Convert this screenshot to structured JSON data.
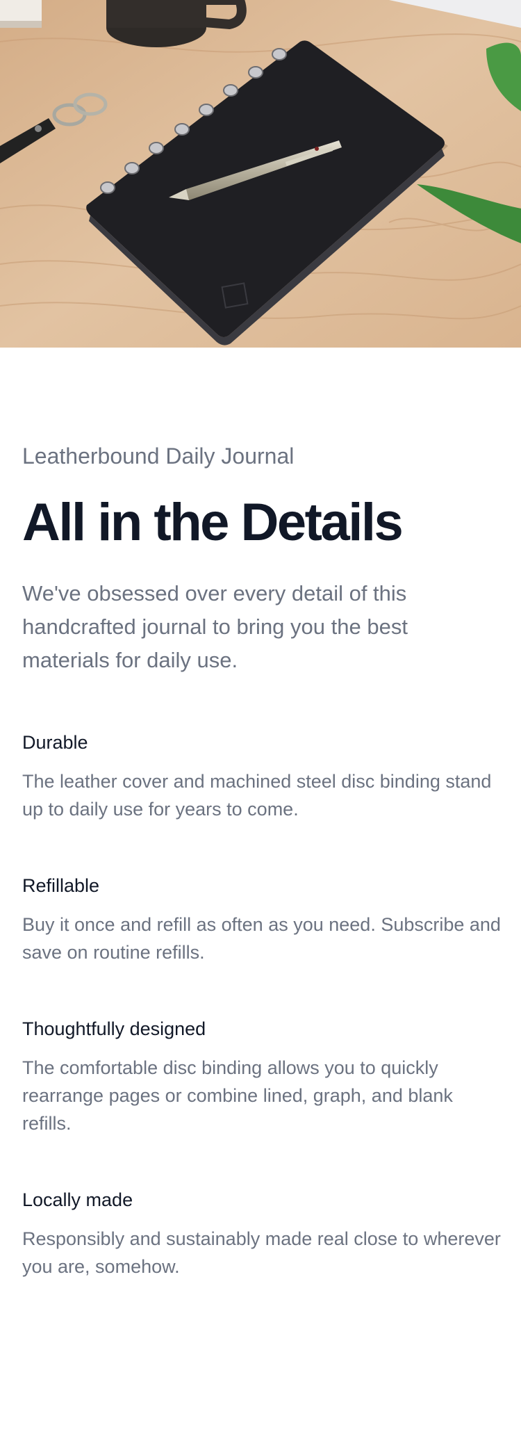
{
  "hero": {
    "image_alt": "Black leather journal with steel disc binding and a silver pen on a light wooden desk, next to a mug, keychain and a green plant"
  },
  "product": {
    "eyebrow": "Leatherbound Daily Journal",
    "headline": "All in the Details",
    "lead": "We've obsessed over every detail of this handcrafted journal to bring you the best materials for daily use."
  },
  "features": [
    {
      "title": "Durable",
      "description": "The leather cover and machined steel disc binding stand up to daily use for years to come."
    },
    {
      "title": "Refillable",
      "description": "Buy it once and refill as often as you need. Subscribe and save on routine refills."
    },
    {
      "title": "Thoughtfully designed",
      "description": "The comfortable disc binding allows you to quickly rearrange pages or combine lined, graph, and blank refills."
    },
    {
      "title": "Locally made",
      "description": "Responsibly and sustainably made real close to wherever you are, somehow."
    }
  ],
  "colors": {
    "heading": "#111827",
    "muted_text": "#6b7280",
    "background": "#ffffff"
  }
}
